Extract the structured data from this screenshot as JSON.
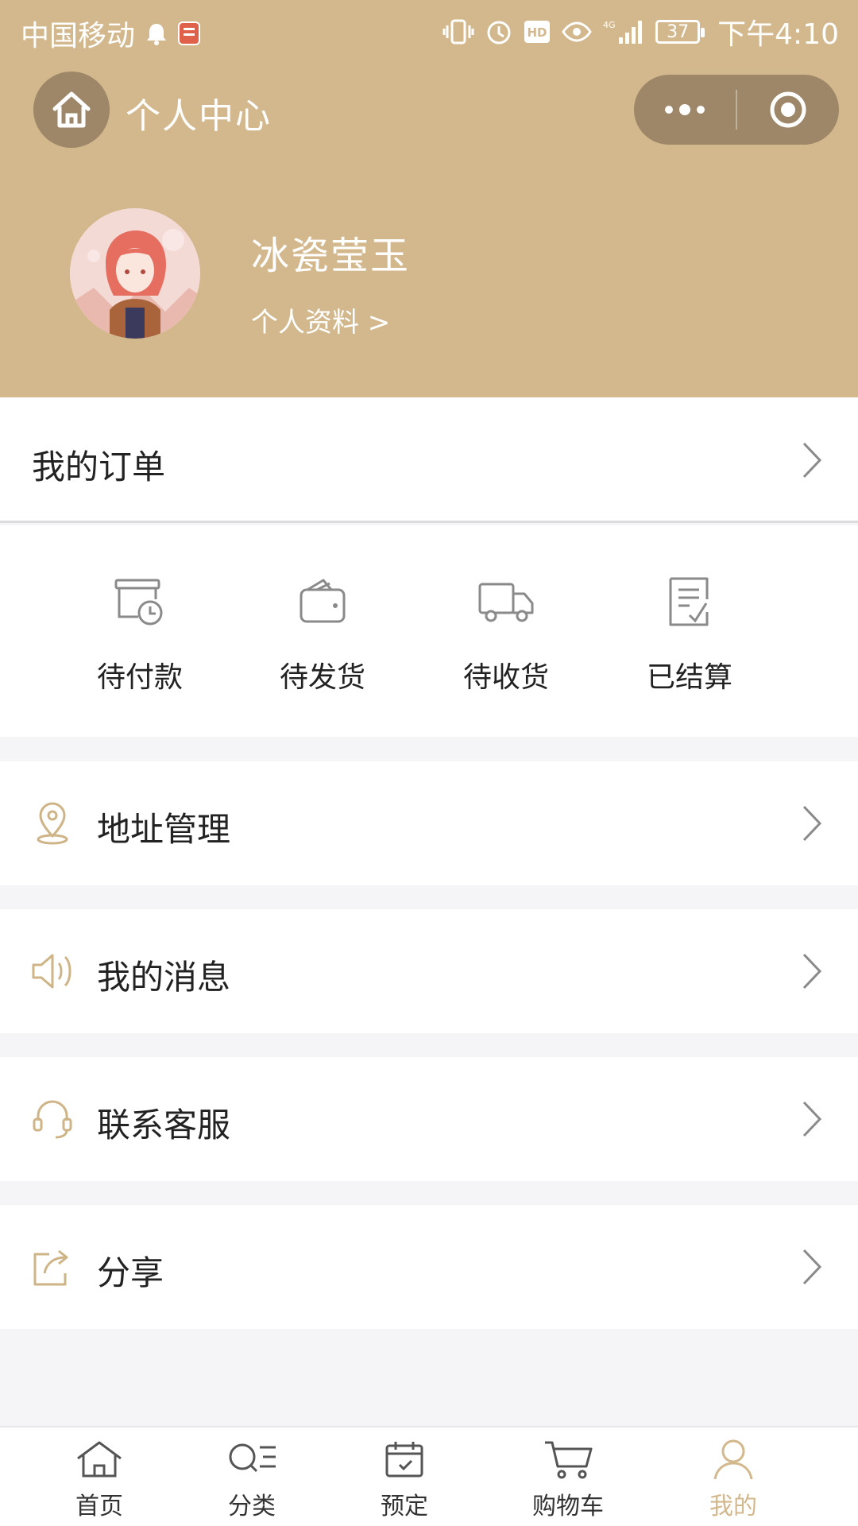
{
  "status_bar": {
    "carrier": "中国移动",
    "network": "4G",
    "battery": "37",
    "time": "下午4:10"
  },
  "nav": {
    "title": "个人中心"
  },
  "profile": {
    "username": "冰瓷莹玉",
    "profile_link": "个人资料 >"
  },
  "orders": {
    "title": "我的订单",
    "items": [
      {
        "label": "待付款",
        "icon": "pending-payment-icon"
      },
      {
        "label": "待发货",
        "icon": "wallet-icon"
      },
      {
        "label": "待收货",
        "icon": "truck-icon"
      },
      {
        "label": "已结算",
        "icon": "settled-document-icon"
      }
    ]
  },
  "menu": [
    {
      "label": "地址管理",
      "icon": "location-pin-icon"
    },
    {
      "label": "我的消息",
      "icon": "speaker-icon"
    },
    {
      "label": "联系客服",
      "icon": "headset-icon"
    },
    {
      "label": "分享",
      "icon": "share-icon"
    }
  ],
  "tabbar": [
    {
      "label": "首页",
      "icon": "home-icon"
    },
    {
      "label": "分类",
      "icon": "category-search-icon"
    },
    {
      "label": "预定",
      "icon": "calendar-icon"
    },
    {
      "label": "购物车",
      "icon": "cart-icon"
    },
    {
      "label": "我的",
      "icon": "user-icon",
      "active": true
    }
  ],
  "colors": {
    "brand": "#d4b88d",
    "capsule": "#9d8768",
    "icon_gold": "#cfb487",
    "icon_gray": "#8a8a8a",
    "background": "#f5f5f7"
  }
}
